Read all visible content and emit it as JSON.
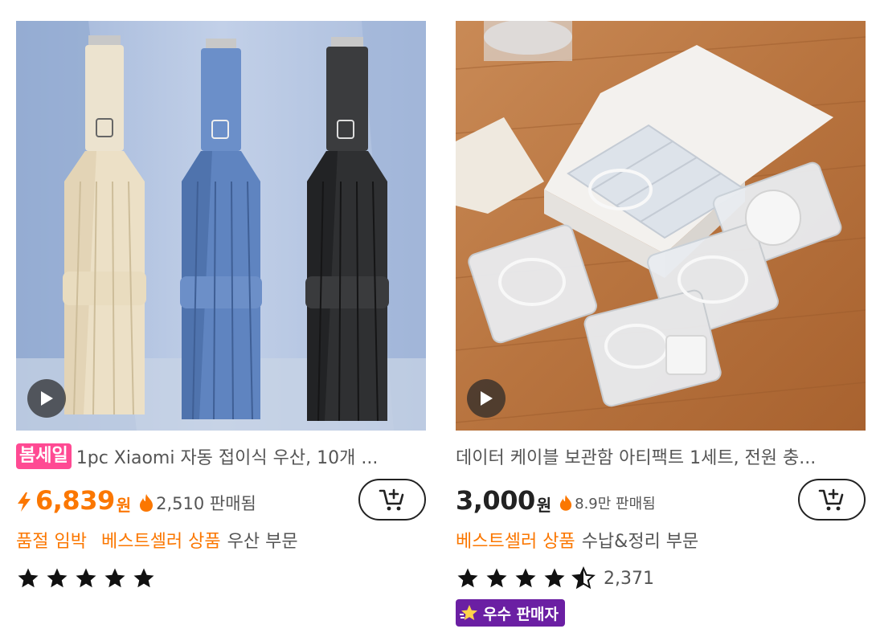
{
  "products": [
    {
      "tag": "봄세일",
      "title": "1pc Xiaomi 자동 접이식 우산, 10개 ...",
      "price": "6,839",
      "currency": "원",
      "sold": "2,510 판매됨",
      "info": [
        "품절 임박",
        "베스트셀러 상품",
        "우산 부문"
      ],
      "rating": 5
    },
    {
      "title": "데이터 케이블 보관함 아티팩트 1세트, 전원 충...",
      "price": "3,000",
      "currency": "원",
      "sold": "8.9만 판매됨",
      "info": [
        "베스트셀러 상품",
        "수납&정리 부문"
      ],
      "rating": 4.5,
      "rating_count": "2,371",
      "seller_badge": "우수 판매자"
    }
  ],
  "colors": {
    "accent": "#fb7701",
    "tag": "#ff4a93",
    "seller_badge": "#6b1fa3"
  }
}
